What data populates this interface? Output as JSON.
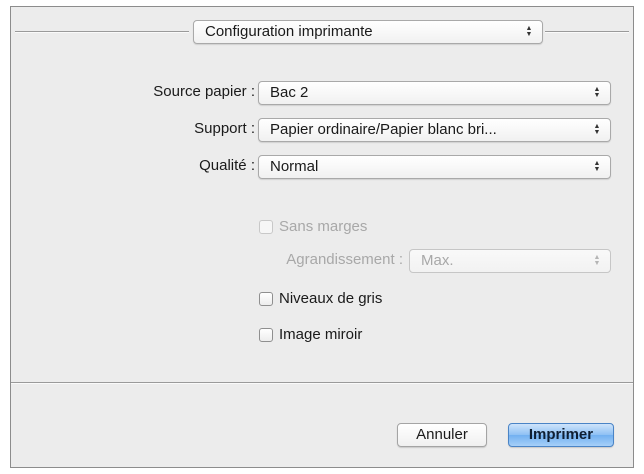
{
  "panel_selector": {
    "value": "Configuration imprimante"
  },
  "settings": [
    {
      "label": "Source papier :",
      "value": "Bac 2"
    },
    {
      "label": "Support :",
      "value": "Papier ordinaire/Papier blanc bri..."
    },
    {
      "label": "Qualité :",
      "value": "Normal"
    }
  ],
  "borderless": {
    "label": "Sans marges",
    "checked": false,
    "enabled": false
  },
  "enlargement": {
    "label": "Agrandissement :",
    "value": "Max.",
    "enabled": false
  },
  "grayscale": {
    "label": "Niveaux de gris",
    "checked": false
  },
  "mirror": {
    "label": "Image miroir",
    "checked": false
  },
  "buttons": {
    "cancel": "Annuler",
    "print": "Imprimer"
  },
  "colors": {
    "dialog_bg": "#ececec",
    "default_button": "#72b0f1"
  }
}
